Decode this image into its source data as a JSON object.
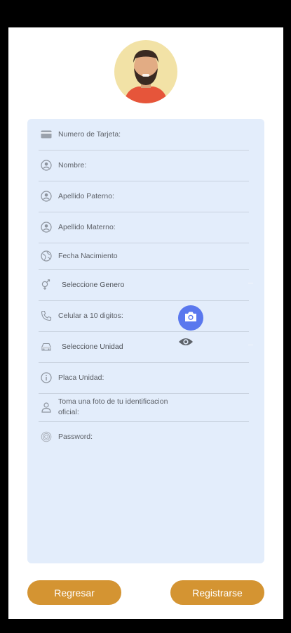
{
  "form": {
    "fields": [
      {
        "label": "Numero de Tarjeta:",
        "icon": "credit-card-icon"
      },
      {
        "label": "Nombre:",
        "icon": "person-circle-icon"
      },
      {
        "label": "Apellido Paterno:",
        "icon": "person-circle-icon"
      },
      {
        "label": "Apellido Materno:",
        "icon": "person-circle-icon"
      },
      {
        "label": "Fecha Nacimiento",
        "icon": "globe-icon"
      },
      {
        "label": "Seleccione Genero",
        "icon": "gender-icon"
      },
      {
        "label": "Celular a 10 digitos:",
        "icon": "phone-icon"
      },
      {
        "label": "Seleccione Unidad",
        "icon": "car-icon"
      },
      {
        "label": "Placa Unidad:",
        "icon": "info-icon"
      },
      {
        "label": "Toma una foto de tu identificacion oficial:",
        "icon": "person-outline-icon"
      },
      {
        "label": "Password:",
        "icon": "fingerprint-icon"
      }
    ]
  },
  "buttons": {
    "back": "Regresar",
    "register": "Registrarse"
  },
  "colors": {
    "card_background": "#e3edfb",
    "button": "#d49432",
    "camera_button": "#5a78ee"
  }
}
